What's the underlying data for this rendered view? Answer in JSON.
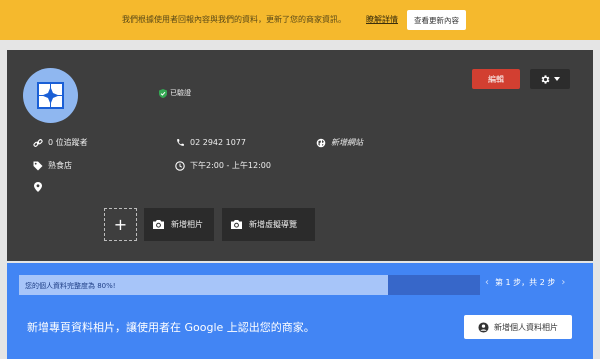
{
  "banner": {
    "message": "我們根據使用者回報內容與我們的資料，更新了您的商家資訊。",
    "details_link": "瞭解詳情",
    "view_updates_button": "查看更新內容"
  },
  "profile": {
    "verified_label": "已驗證",
    "edit_button": "編輯",
    "followers": "0 位追蹤者",
    "category": "熟食店",
    "phone": "02 2942 1077",
    "hours": "下午2:00 - 上午12:00",
    "website": "新增網站",
    "add_photo_symbol": "+",
    "add_photos_button": "新增相片",
    "add_virtual_tour_button": "新增虛擬導覽"
  },
  "completion": {
    "progress_text": "您的個人資料完整度為 80%!",
    "progress_percent": 80,
    "step_text": "第 1 步，共 2 步",
    "prev_symbol": "‹",
    "next_symbol": "›",
    "promo_text": "新增專頁資料相片，讓使用者在 Google 上認出您的商家。",
    "add_profile_photo_button": "新增個人資料相片"
  },
  "colors": {
    "banner": "#f5b92d",
    "card": "#3e3e3e",
    "edit": "#d23f31",
    "blue_panel": "#4285f4",
    "verified": "#34a853"
  },
  "icons": [
    "link-icon",
    "tag-icon",
    "map-pin-icon",
    "phone-icon",
    "clock-icon",
    "globe-icon",
    "camera-icon",
    "gear-icon",
    "verified-check-icon",
    "person-icon",
    "chevron-left-icon",
    "chevron-right-icon"
  ]
}
